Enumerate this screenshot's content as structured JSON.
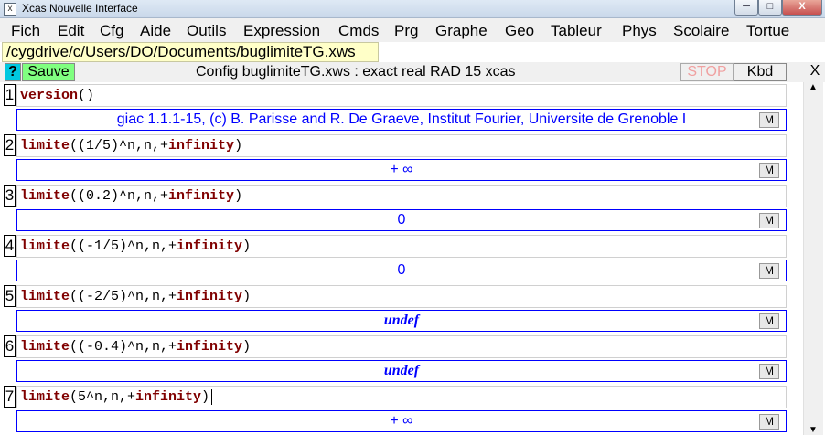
{
  "window": {
    "title": "Xcas Nouvelle Interface",
    "min": "─",
    "max": "□",
    "close": "X"
  },
  "menu": [
    "Fich",
    "Edit",
    "Cfg",
    "Aide",
    "Outils",
    "Expression",
    "Cmds",
    "Prg",
    "Graphe",
    "Geo",
    "Tableur",
    "Phys",
    "Scolaire",
    "Tortue"
  ],
  "path": "/cygdrive/c/Users/DO/Documents/buglimiteTG.xws",
  "toolbar": {
    "help": "?",
    "save": "Sauve",
    "config": "Config buglimiteTG.xws : exact real RAD 15 xcas",
    "stop": "STOP",
    "kbd": "Kbd",
    "close": "X"
  },
  "levels": [
    {
      "num": "1",
      "kw": "version",
      "args": "()",
      "result": "giac 1.1.1-15, (c) B. Parisse and R. De Graeve, Institut Fourier, Universite de Grenoble I",
      "m": "M"
    },
    {
      "num": "2",
      "kw": "limite",
      "args_pre": "((1/5)^n,n,+",
      "kw2": "infinity",
      "args_post": ")",
      "result": "+ ∞",
      "m": "M"
    },
    {
      "num": "3",
      "kw": "limite",
      "args_pre": "((0.2)^n,n,+",
      "kw2": "infinity",
      "args_post": ")",
      "result": "0",
      "m": "M"
    },
    {
      "num": "4",
      "kw": "limite",
      "args_pre": "((-1/5)^n,n,+",
      "kw2": "infinity",
      "args_post": ")",
      "result": "0",
      "m": "M"
    },
    {
      "num": "5",
      "kw": "limite",
      "args_pre": "((-2/5)^n,n,+",
      "kw2": "infinity",
      "args_post": ")",
      "result": "undef",
      "m": "M"
    },
    {
      "num": "6",
      "kw": "limite",
      "args_pre": "((-0.4)^n,n,+",
      "kw2": "infinity",
      "args_post": ")",
      "result": "undef",
      "m": "M"
    },
    {
      "num": "7",
      "kw": "limite",
      "args_pre": "(5^n,n,+",
      "kw2": "infinity",
      "args_post": ")",
      "result": "+ ∞",
      "m": "M"
    }
  ],
  "scrollbar": {
    "up": "▲",
    "down": "▼"
  }
}
